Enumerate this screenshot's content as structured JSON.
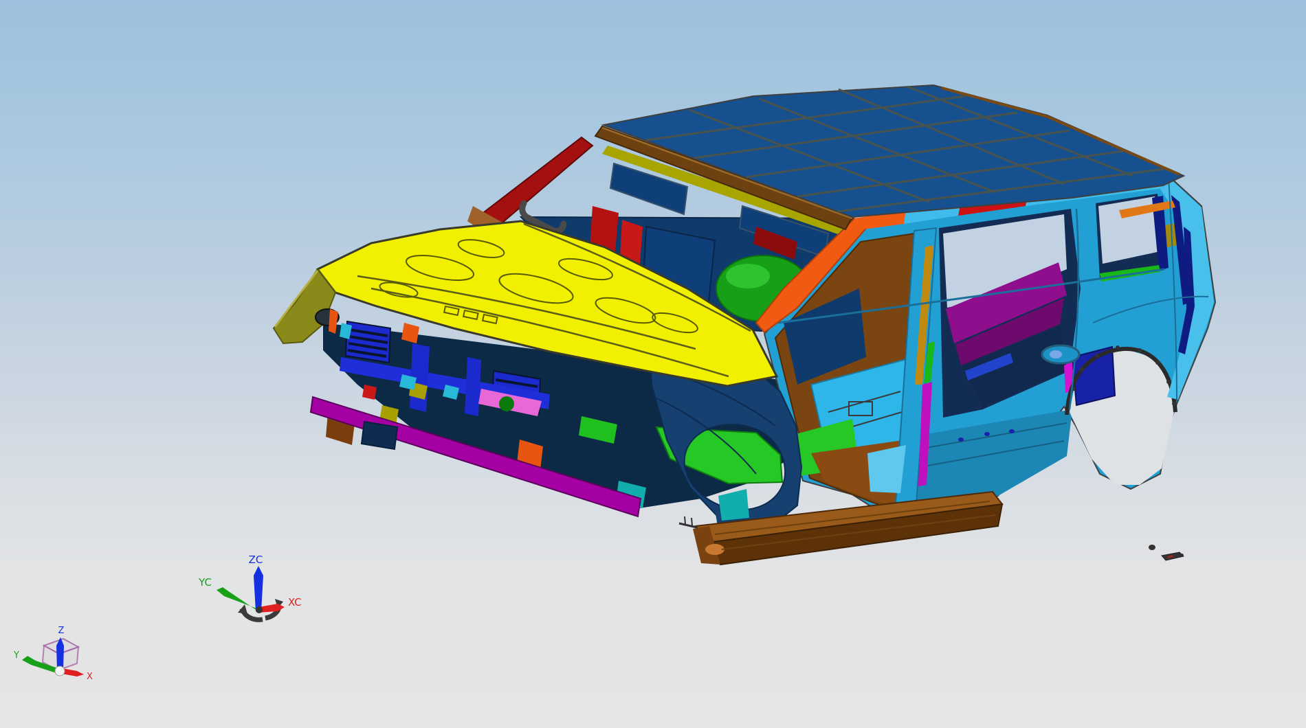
{
  "viewport": {
    "description": "CAD 3D viewport showing a multi-colored automotive body-in-white (SUV body shell) in isometric view",
    "background_top": "#9cc0dd",
    "background_bottom": "#e5e5e5",
    "wcs_triad": {
      "x_label": "XC",
      "y_label": "YC",
      "z_label": "ZC"
    },
    "abs_triad": {
      "x_label": "X",
      "y_label": "Y",
      "z_label": "Z"
    },
    "palette": {
      "sky_window": "#c3d2e2",
      "arch_bg": "#dfe2e5",
      "edge_dark": "#3f3f3f",
      "roof": "#17508e",
      "roof_line": "#4e5448",
      "roof_edge_brown": "#7a4a14",
      "header_brown": "#6e4210",
      "header_highlight": "#9a6a28",
      "header_olive": "#a8a400",
      "rail_orange": "#f05a12",
      "rail_cyan": "#3fbceb",
      "rail_red": "#cc1212",
      "apillar_orange": "#f05a12",
      "apillar_red": "#a41010",
      "body_cyan": "#22a0d4",
      "dpillar_cyan": "#49c0ec",
      "rocker_teal": "#1c86b4",
      "pillar_navy": "#0e1c82",
      "hood_yellow": "#f0f000",
      "hood_line": "#6a6a00",
      "fender_rail_olive": "#8a8a1a",
      "fender_rail_hi": "#b8b040",
      "fender_navy": "#15406f",
      "interior_navy": "#0f3a6c",
      "dash_navy": "#0e3f78",
      "cowl_magenta": "#c814c8",
      "interior_red": "#b41212",
      "dark_red_box": "#8a0c0c",
      "hump_green": "#17a017",
      "hump_green_hi": "#2fc42f",
      "floor_green": "#25c825",
      "floor_brown": "#7a4510",
      "sill_brown": "#8a4a12",
      "floor_cyan": "#2fb6e8",
      "sill_cyan": "#5fc8ee",
      "sill_teal": "#12adad",
      "board_top": "#9a5a1a",
      "board_side": "#5e3208",
      "board_cap": "#7a4210",
      "board_copper": "#c87830",
      "bumper_magenta": "#a400a4",
      "radiator_blue": "#1b2acc",
      "crossbar_blue": "#1e2ed8",
      "clip_dark": "#0c2a46",
      "orange_part": "#e85510",
      "pink_part": "#e868d8",
      "green_part": "#20c020",
      "dark_green": "#0a7a0a",
      "dark_yellow": "#a8a000",
      "cyan_part": "#28b8d8",
      "red_part": "#c81818",
      "brown_part": "#7a3e0e",
      "brown_curve": "#a0622a",
      "pale_green": "#b0e8c0",
      "quarter_purple": "#8e0e8e",
      "quarter_purple_dark": "#6e0a6e",
      "bpillar_amber": "#c08a10",
      "seal_magenta": "#be10be",
      "seal_green": "#18b818",
      "navy_box": "#1822a8",
      "magenta_sliver": "#d214d2",
      "bolt_navy": "#1822b0",
      "olive_bracket": "#a08a10",
      "orange_bracket": "#e07818",
      "handle_gray": "#4a4a4a",
      "headlight_dark": "#26333b",
      "tow_navy": "#0e2c50",
      "fastener_dark": "#333333",
      "fastener_red": "#a02020",
      "wcs_dark": "#3a3a3a",
      "cube_edge": "#a868a8",
      "cube_face": "#dcdce0",
      "sphere_white": "#f0f0f0",
      "axis_red": "#e02020",
      "axis_green": "#18a018",
      "axis_blue": "#1430e0"
    },
    "parts": [
      "roof-panel",
      "windshield-header",
      "roof-side-rail",
      "a-pillar",
      "b-pillar",
      "d-pillar",
      "body-side-outer",
      "rear-door-opening",
      "quarter-window-opening",
      "rear-wheel-arch",
      "hood-panel",
      "front-fender-rail",
      "front-wheelhouse",
      "radiator-support",
      "front-bumper-crossmember",
      "floor-pan",
      "rocker-running-board",
      "cowl-trim",
      "dash-panel",
      "transmission-hump",
      "quarter-trim-panel"
    ]
  }
}
